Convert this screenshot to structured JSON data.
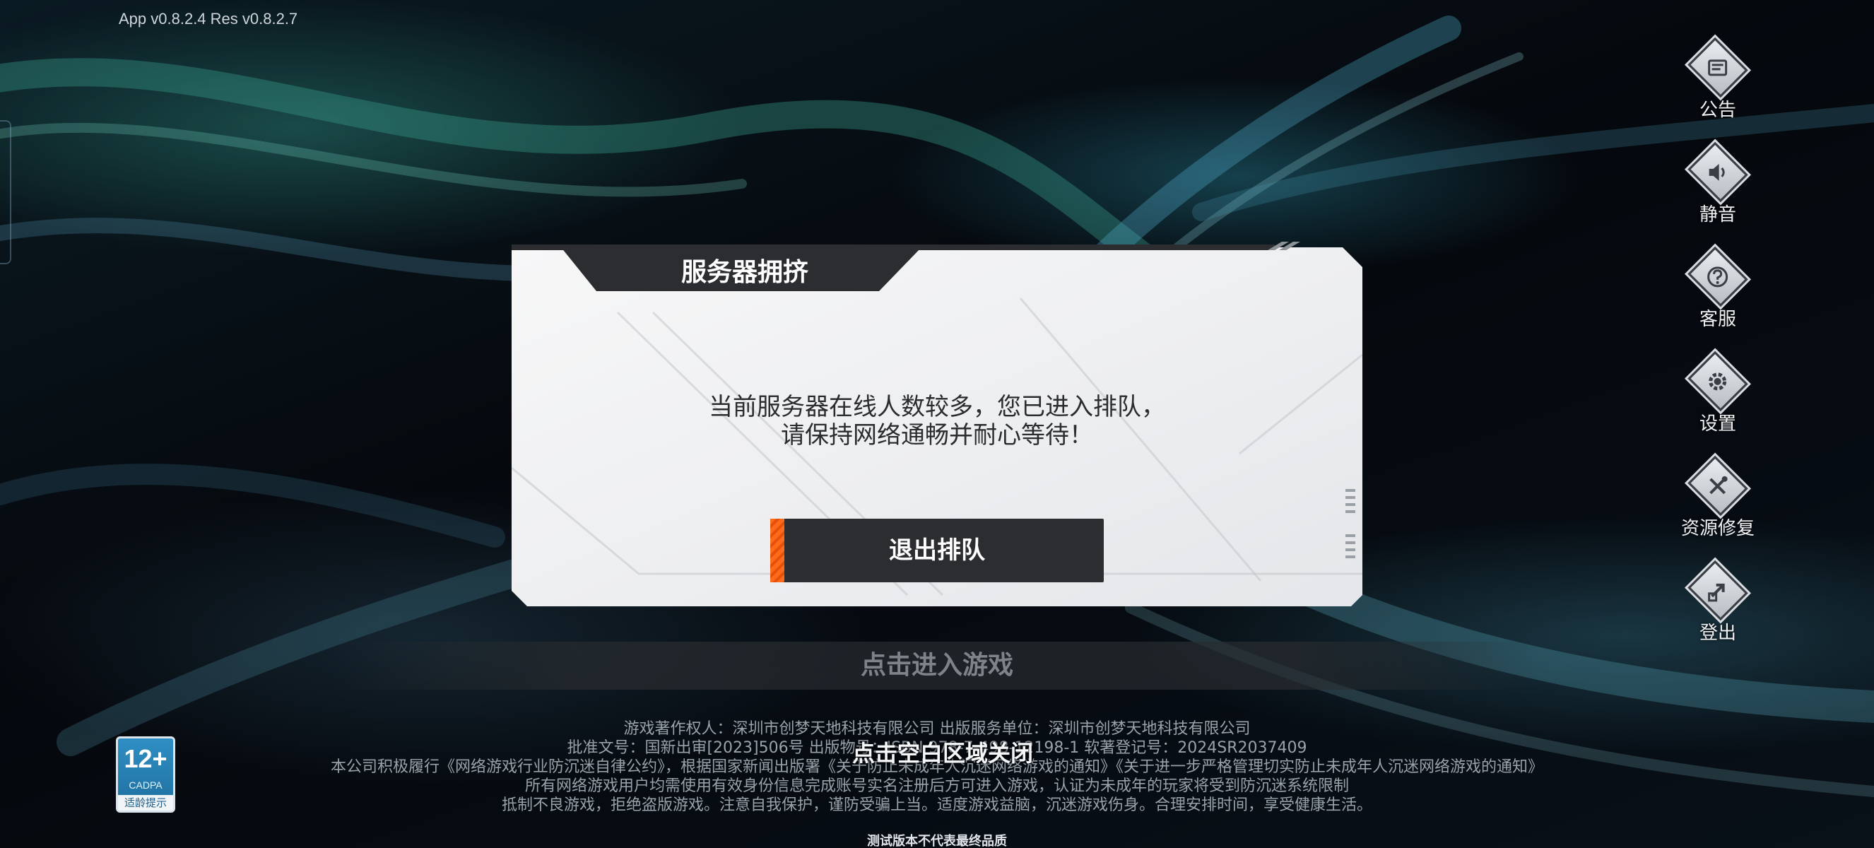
{
  "app": {
    "version_text": "App v0.8.2.4 Res v0.8.2.7"
  },
  "sidebar": {
    "items": [
      {
        "label": "公告",
        "icon": "announcement-icon"
      },
      {
        "label": "静音",
        "icon": "speaker-icon"
      },
      {
        "label": "客服",
        "icon": "question-icon"
      },
      {
        "label": "设置",
        "icon": "gear-icon"
      },
      {
        "label": "资源修复",
        "icon": "tools-icon"
      },
      {
        "label": "登出",
        "icon": "logout-icon"
      }
    ]
  },
  "dialog": {
    "title": "服务器拥挤",
    "message_line1": "当前服务器在线人数较多，您已进入排队，",
    "message_line2": "请保持网络通畅并耐心等待！",
    "exit_button_label": "退出排队"
  },
  "main": {
    "enter_game_label": "点击进入游戏",
    "close_hint": "点击空白区域关闭"
  },
  "footer": {
    "line1": "游戏著作权人：深圳市创梦天地科技有限公司   出版服务单位：深圳市创梦天地科技有限公司",
    "line2": "批准文号：国新出审[2023]506号   出版物号：ISBN 978-7-498-12198-1   软著登记号：2024SR2037409",
    "line3": "本公司积极履行《网络游戏行业防沉迷自律公约》，根据国家新闻出版署《关于防止未成年人沉迷网络游戏的通知》《关于进一步严格管理切实防止未成年人沉迷网络游戏的通知》",
    "line4": "所有网络游戏用户均需使用有效身份信息完成账号实名注册后方可进入游戏，认证为未成年的玩家将受到防沉迷系统限制",
    "line5": "抵制不良游戏，拒绝盗版游戏。注意自我保护，谨防受骗上当。适度游戏益脑，沉迷游戏伤身。合理安排时间，享受健康生活。",
    "test_note": "测试版本不代表最终品质"
  },
  "age_badge": {
    "rating": "12+",
    "org": "CADPA",
    "hint": "适龄提示"
  },
  "colors": {
    "accent_orange": "#ff6a1a",
    "dialog_dark": "#2c2d31",
    "dialog_light": "#f1f2f4"
  }
}
